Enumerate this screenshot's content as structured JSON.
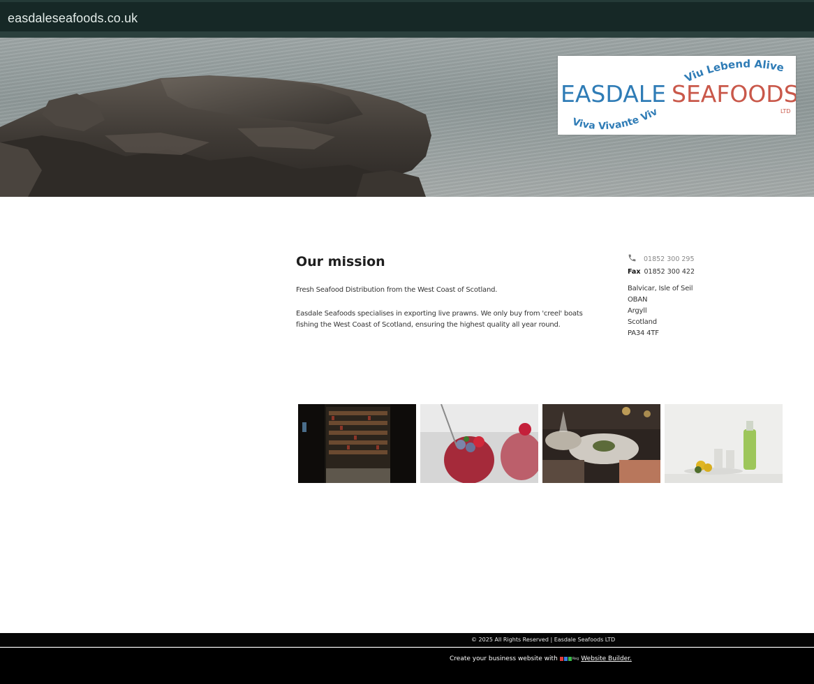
{
  "header": {
    "site_title": "easdaleseafoods.co.uk"
  },
  "logo": {
    "left_word": "EASDALE",
    "right_word": "SEAFOODS",
    "top_arc": "Viu Lebend Alive",
    "bottom_arc": "Viva Vivante Vivi",
    "suffix": "LTD",
    "colors": {
      "blue": "#2f7cb6",
      "red": "#c9584a"
    }
  },
  "mission": {
    "title": "Our mission",
    "intro": "Fresh Seafood Distribution from the West Coast of Scotland.",
    "body": "Easdale Seafoods specialises in exporting live prawns. We only buy from 'creel' boats fishing the West Coast of Scotland, ensuring the highest quality all year round."
  },
  "contact": {
    "phone": "01852 300 295",
    "fax_label": "Fax",
    "fax": "01852 300 422",
    "address": [
      "Balvicar, Isle of Seil",
      "OBAN",
      "Argyll",
      "Scotland",
      "PA34 4TF"
    ]
  },
  "gallery": [
    {
      "name": "wine-shop-image"
    },
    {
      "name": "berry-drink-image"
    },
    {
      "name": "restaurant-dining-image"
    },
    {
      "name": "lime-drink-image"
    }
  ],
  "footer": {
    "copyright": "© 2025 All Rights Reserved | Easdale Seafoods LTD",
    "builder_prefix": "Create your business website with",
    "builder_brand": "123 Reg",
    "builder_link": "Website Builder."
  }
}
